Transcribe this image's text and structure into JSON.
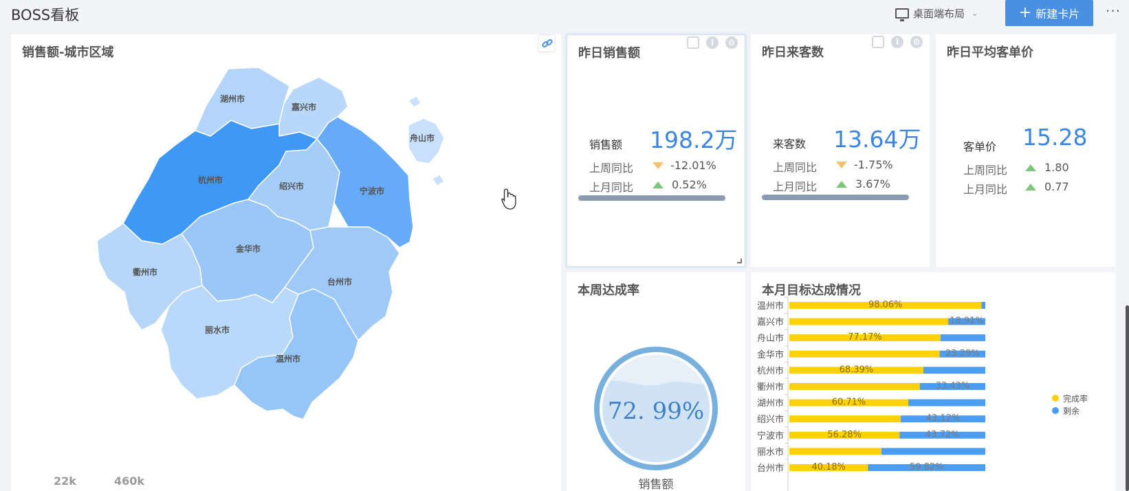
{
  "app": {
    "title": "BOSS看板",
    "layout_selector": "桌面端布局",
    "new_card_button": "新建卡片",
    "more_icon": "more-icon"
  },
  "colors": {
    "accent": "#4a90e2",
    "map_darkest": "#3f97f6",
    "map_lightest": "#c8e0fb",
    "completion": "#fdd107",
    "remaining": "#4a9df0",
    "trend_down": "#f5c26b",
    "trend_up": "#7fc57b"
  },
  "map_card": {
    "title": "销售额-城市区域",
    "legend_min": "22k",
    "legend_max": "460k",
    "regions": [
      {
        "name": "湖州市",
        "fill": "#b3d5fa"
      },
      {
        "name": "嘉兴市",
        "fill": "#b8d8fa"
      },
      {
        "name": "舟山市",
        "fill": "#c8e0fb"
      },
      {
        "name": "杭州市",
        "fill": "#3f97f6"
      },
      {
        "name": "绍兴市",
        "fill": "#a5cdf8"
      },
      {
        "name": "宁波市",
        "fill": "#65abf7"
      },
      {
        "name": "衢州市",
        "fill": "#b6d7fa"
      },
      {
        "name": "金华市",
        "fill": "#9bc7f8"
      },
      {
        "name": "台州市",
        "fill": "#9fcaf8"
      },
      {
        "name": "丽水市",
        "fill": "#b9d9fa"
      },
      {
        "name": "温州市",
        "fill": "#96c5f8"
      }
    ]
  },
  "kpi_cards": [
    {
      "title": "昨日销售额",
      "main_label": "销售额",
      "main_value": "198.2万",
      "rows": [
        {
          "label": "上周同比",
          "value": "-12.01%",
          "trend": "down"
        },
        {
          "label": "上月同比",
          "value": "0.52%",
          "trend": "up"
        }
      ]
    },
    {
      "title": "昨日来客数",
      "main_label": "来客数",
      "main_value": "13.64万",
      "rows": [
        {
          "label": "上周同比",
          "value": "-1.75%",
          "trend": "down"
        },
        {
          "label": "上月同比",
          "value": "3.67%",
          "trend": "up"
        }
      ]
    },
    {
      "title": "昨日平均客单价",
      "main_label": "客单价",
      "main_value": "15.28",
      "rows": [
        {
          "label": "上周同比",
          "value": "1.80",
          "trend": "up"
        },
        {
          "label": "上月同比",
          "value": "0.77",
          "trend": "up"
        }
      ]
    }
  ],
  "gauge_card": {
    "title": "本周达成率",
    "value_text": "72. 99%",
    "value": 72.99,
    "label": "销售额"
  },
  "bar_card": {
    "title": "本月目标达成情况",
    "chart_data": {
      "type": "bar",
      "orientation": "horizontal",
      "stacked": true,
      "categories": [
        "温州市",
        "嘉兴市",
        "舟山市",
        "金华市",
        "杭州市",
        "衢州市",
        "湖州市",
        "绍兴市",
        "宁波市",
        "丽水市",
        "台州市"
      ],
      "series": [
        {
          "name": "完成率",
          "values": [
            98.06,
            81.09,
            77.17,
            76.71,
            68.39,
            66.57,
            60.71,
            56.88,
            56.28,
            47.0,
            40.18
          ],
          "labels": [
            "98.06%",
            "",
            "77.17%",
            "",
            "68.39%",
            "",
            "60.71%",
            "",
            "56.28%",
            "",
            "40.18%"
          ]
        },
        {
          "name": "剩余",
          "values": [
            1.94,
            18.91,
            22.83,
            23.29,
            31.61,
            33.43,
            39.29,
            43.12,
            43.72,
            53.0,
            59.82
          ],
          "labels": [
            "",
            "18.91%",
            "",
            "23.29%",
            "",
            "33.43%",
            "",
            "43.12%",
            "43.72%",
            "",
            "59.82%"
          ]
        }
      ],
      "xlim": [
        0,
        100
      ],
      "legend": "right"
    }
  }
}
